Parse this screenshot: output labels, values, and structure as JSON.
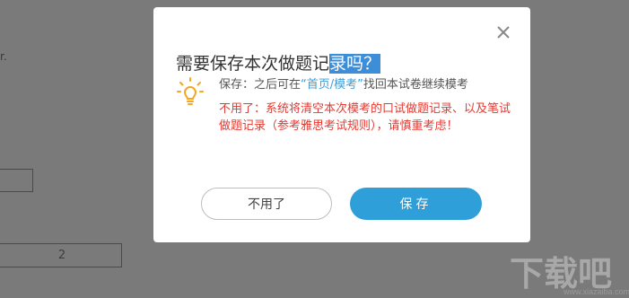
{
  "background": {
    "fragment_text": "r.",
    "input_value": "2",
    "watermark_text": "下载吧",
    "watermark_url": "www.xiazaiba.com"
  },
  "dialog": {
    "title_plain": "需要保存本次做题记",
    "title_selected": "录吗？",
    "save_label": "保存：之后可在",
    "save_link": "“首页/模考”",
    "save_rest": "找回本试卷继续模考",
    "warn_text": "不用了：系统将清空本次模考的口试做题记录、以及笔试做题记录（参考雅思考试规则），请慎重考虑！",
    "cancel_button": "不用了",
    "save_button": "保存",
    "close_icon": "close-icon",
    "hint_icon": "lightbulb-icon"
  },
  "colors": {
    "overlay": "#7a7a7a",
    "accent": "#2e9fd9",
    "link": "#3a9ed8",
    "warning": "#e33a32",
    "bulb": "#f5a623",
    "selection": "#3c8ed8"
  }
}
